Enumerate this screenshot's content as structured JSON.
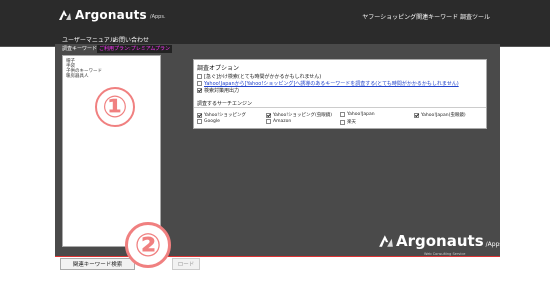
{
  "header": {
    "logo_name": "Argonauts",
    "logo_sub": "/Apps.",
    "app_title": "ヤフーショッピング関連キーワード 調査ツール"
  },
  "menu": {
    "items": [
      {
        "label": "ユーザーマニュアル"
      },
      {
        "label": "お問い合わせ"
      }
    ]
  },
  "keyword_panel": {
    "tab_label": "調査キーワード",
    "tab_active": "ご利用プラン:プレミアムプラン",
    "lines": [
      "帽子",
      "手袋",
      "子供のキーワード",
      "暖房器具人"
    ]
  },
  "options": {
    "title": "調査オプション",
    "items": [
      {
        "label": "[急ぐ]かけ検索(とても時間がかかるかもしれません)",
        "checked": false,
        "link": false
      },
      {
        "label": "Yahoo!Japanから[Yahoo!ショッピング]へ誘導のあるキーワードを調査する(とても時間がかかるかもしれません)",
        "checked": false,
        "link": true
      },
      {
        "label": "検索対策用出力",
        "checked": true,
        "link": false
      }
    ]
  },
  "engines": {
    "title": "調査するサーチエンジン",
    "items": [
      {
        "label": "Yahoo!ショッピング",
        "checked": true
      },
      {
        "label": "Yahoo!ショッピング(虫眼鏡)",
        "checked": true
      },
      {
        "label": "Yahoo!Japan",
        "checked": false
      },
      {
        "label": "Yahoo!Japan(虫眼鏡)",
        "checked": true
      },
      {
        "label": "Google",
        "checked": false
      },
      {
        "label": "Amazon",
        "checked": false
      },
      {
        "label": "楽天",
        "checked": false
      }
    ]
  },
  "annotations": {
    "circle1": "①",
    "circle2": "②"
  },
  "footer": {
    "logo_name": "Argonauts",
    "logo_sub": "/Apps.",
    "tagline": "Web Consulting Service",
    "search_button": "関連キーワード検索",
    "download_button": "ロード"
  }
}
